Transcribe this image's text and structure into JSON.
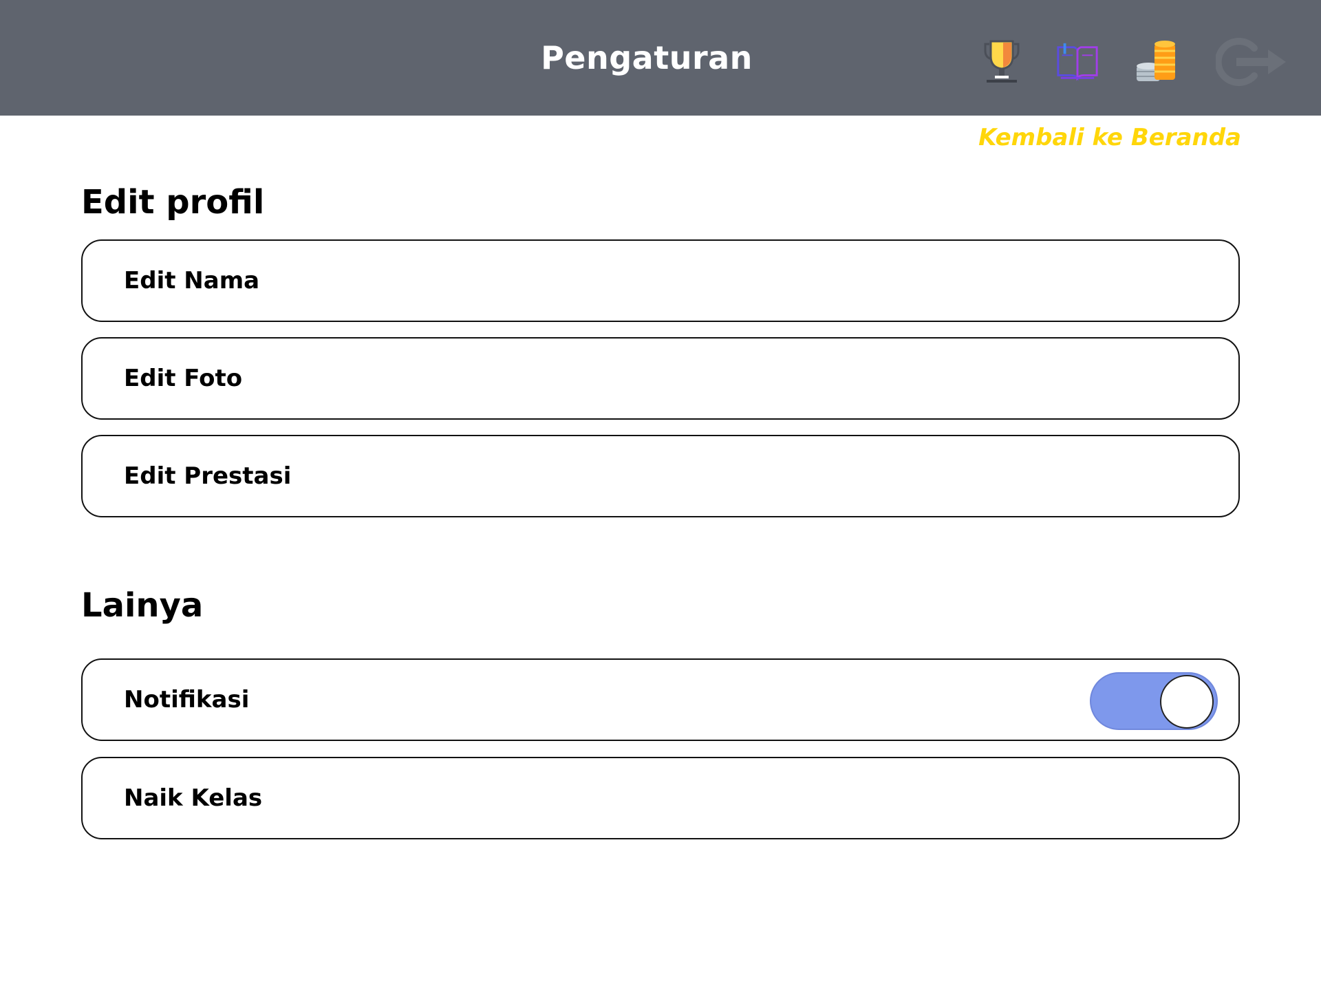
{
  "header": {
    "title": "Pengaturan",
    "icons": [
      "trophy-icon",
      "book-icon",
      "coins-icon",
      "logout-icon"
    ]
  },
  "back_link": "Kembali ke Beranda",
  "sections": {
    "profile": {
      "title": "Edit profil",
      "items": [
        "Edit Nama",
        "Edit Foto",
        "Edit Prestasi"
      ]
    },
    "other": {
      "title": "Lainya",
      "items": [
        "Notifikasi",
        "Naik Kelas"
      ]
    }
  },
  "notification_toggle": {
    "on": true
  },
  "colors": {
    "header_bg": "#5f646e",
    "back_link": "#ffd60a",
    "toggle_on": "#7e98ec"
  }
}
